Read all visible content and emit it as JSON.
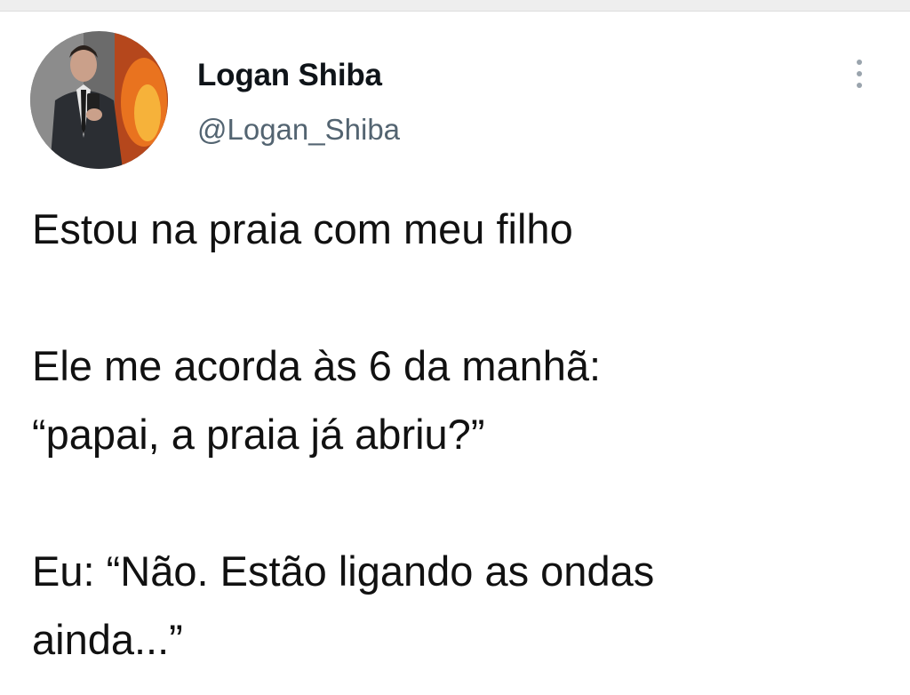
{
  "author": {
    "display_name": "Logan Shiba",
    "handle": "@Logan_Shiba",
    "avatar_icon": "profile-photo"
  },
  "menu": {
    "icon": "more-vertical-icon"
  },
  "tweet": {
    "lines": [
      "Estou na praia com meu filho",
      "",
      "Ele me acorda às 6 da manhã:",
      "“papai, a praia já abriu?”",
      "",
      "Eu: “Não. Estão ligando as ondas",
      "ainda...”"
    ]
  },
  "colors": {
    "text": "#111111",
    "handle": "#536471",
    "menu_dots": "#9aa4ad",
    "background": "#ffffff"
  }
}
